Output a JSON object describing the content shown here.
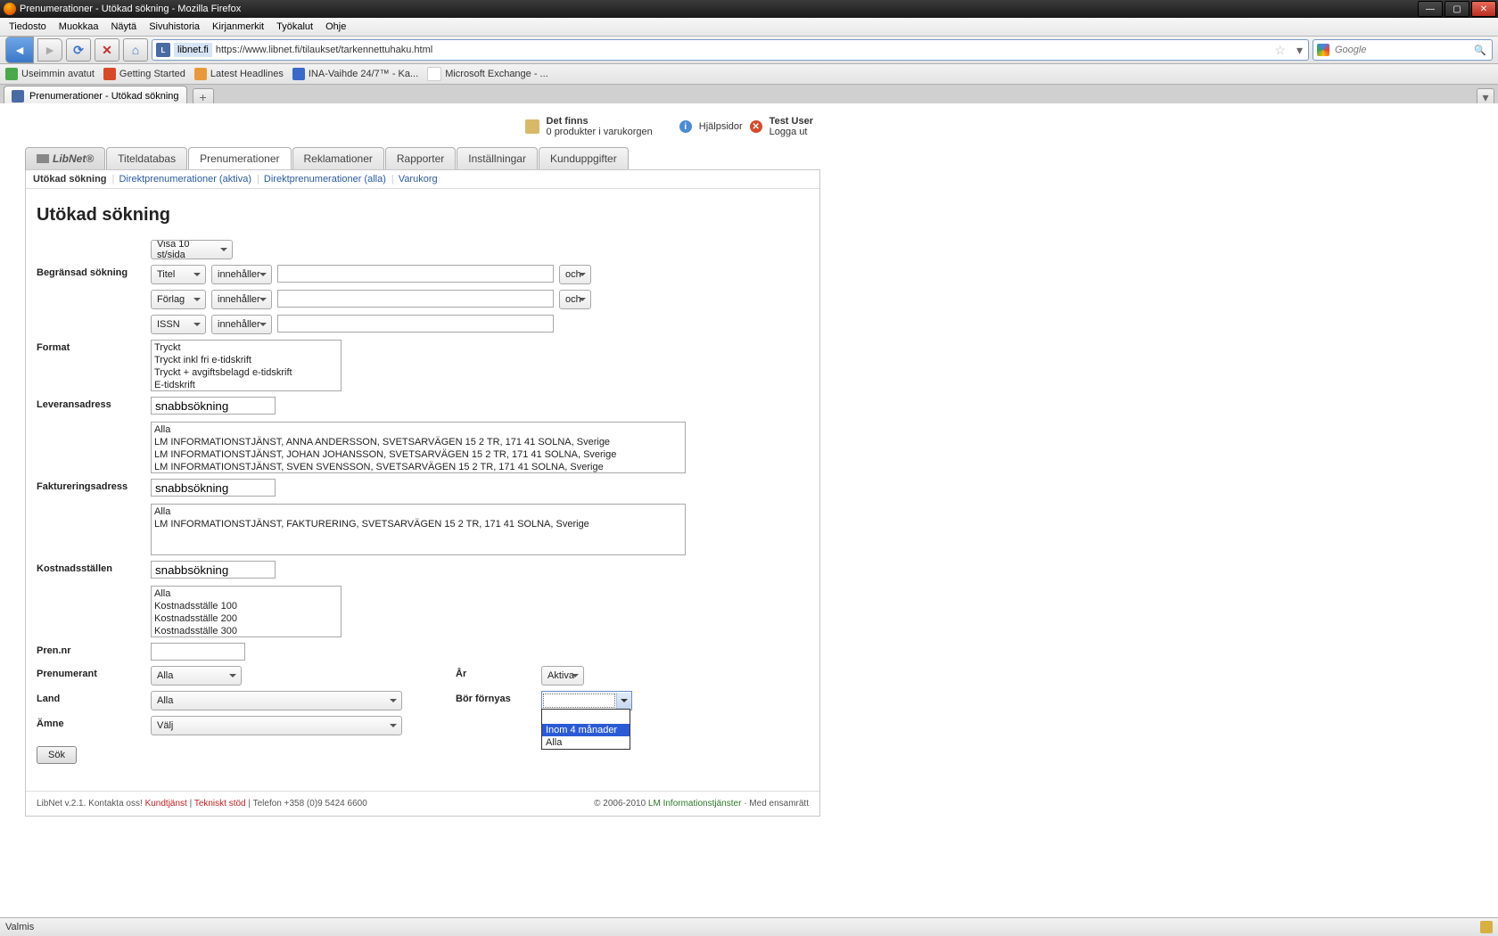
{
  "window": {
    "title": "Prenumerationer - Utökad sökning - Mozilla Firefox",
    "min": "—",
    "max": "▢",
    "close": "✕"
  },
  "menubar": [
    "Tiedosto",
    "Muokkaa",
    "Näytä",
    "Sivuhistoria",
    "Kirjanmerkit",
    "Työkalut",
    "Ohje"
  ],
  "url": {
    "site": "libnet.fi",
    "rest": "https://www.libnet.fi/tilaukset/tarkennettuhaku.html"
  },
  "search": {
    "placeholder": "Google"
  },
  "bookmarks": [
    "Useimmin avatut",
    "Getting Started",
    "Latest Headlines",
    "INA-Vaihde 24/7™ - Ka...",
    "Microsoft Exchange - ..."
  ],
  "tab": {
    "label": "Prenumerationer - Utökad sökning"
  },
  "header": {
    "cart_l1": "Det finns",
    "cart_l2": "0 produkter i varukorgen",
    "help": "Hjälpsidor",
    "user": "Test User",
    "logout": "Logga ut"
  },
  "main_tabs": {
    "logo": "LibNet®",
    "items": [
      "Titeldatabas",
      "Prenumerationer",
      "Reklamationer",
      "Rapporter",
      "Inställningar",
      "Kunduppgifter"
    ],
    "active_index": 1
  },
  "sub_tabs": {
    "items": [
      "Utökad sökning",
      "Direktprenumerationer (aktiva)",
      "Direktprenumerationer (alla)",
      "Varukorg"
    ],
    "active_index": 0
  },
  "page_title": "Utökad sökning",
  "form": {
    "per_page": "Visa 10 st/sida",
    "limited_search": {
      "label": "Begränsad sökning",
      "rows": [
        {
          "field": "Titel",
          "op": "innehåller",
          "bool": "och"
        },
        {
          "field": "Förlag",
          "op": "innehåller",
          "bool": "och"
        },
        {
          "field": "ISSN",
          "op": "innehåller"
        }
      ]
    },
    "format": {
      "label": "Format",
      "options": [
        "Tryckt",
        "Tryckt inkl fri e-tidskrift",
        "Tryckt + avgiftsbelagd e-tidskrift",
        "E-tidskrift"
      ]
    },
    "delivery": {
      "label": "Leveransadress",
      "quick": "snabbsökning",
      "options": [
        "Alla",
        "LM INFORMATIONSTJÄNST, ANNA ANDERSSON, SVETSARVÄGEN 15 2 TR, 171 41 SOLNA, Sverige",
        "LM INFORMATIONSTJÄNST, JOHAN JOHANSSON, SVETSARVÄGEN 15 2 TR, 171 41 SOLNA, Sverige",
        "LM INFORMATIONSTJÄNST, SVEN SVENSSON, SVETSARVÄGEN 15 2 TR, 171 41 SOLNA, Sverige"
      ]
    },
    "billing": {
      "label": "Faktureringsadress",
      "quick": "snabbsökning",
      "options": [
        "Alla",
        "LM INFORMATIONSTJÄNST, FAKTURERING, SVETSARVÄGEN 15 2 TR, 171 41 SOLNA, Sverige"
      ]
    },
    "cost_centers": {
      "label": "Kostnadsställen",
      "quick": "snabbsökning",
      "options": [
        "Alla",
        "Kostnadsställe 100",
        "Kostnadsställe 200",
        "Kostnadsställe 300"
      ]
    },
    "pren_nr": {
      "label": "Pren.nr"
    },
    "subscriber": {
      "label": "Prenumerant",
      "value": "Alla"
    },
    "country": {
      "label": "Land",
      "value": "Alla"
    },
    "subject": {
      "label": "Ämne",
      "value": "Välj"
    },
    "year": {
      "label": "År",
      "value": "Aktiva"
    },
    "renew": {
      "label": "Bör förnyas",
      "open_options": [
        "",
        "Inom 4 månader",
        "Alla"
      ],
      "highlighted_index": 1
    },
    "search_btn": "Sök"
  },
  "footer": {
    "left1": "LibNet v.2.1. Kontakta oss! ",
    "kund": "Kundtjänst",
    "sep": " | ",
    "tek": "Tekniskt stöd",
    "tel": " | Telefon +358 (0)9 5424 6600",
    "right1": "© 2006-2010 ",
    "right_link": "LM Informationstjänster",
    "right2": " · Med ensamrätt"
  },
  "status": {
    "text": "Valmis"
  }
}
